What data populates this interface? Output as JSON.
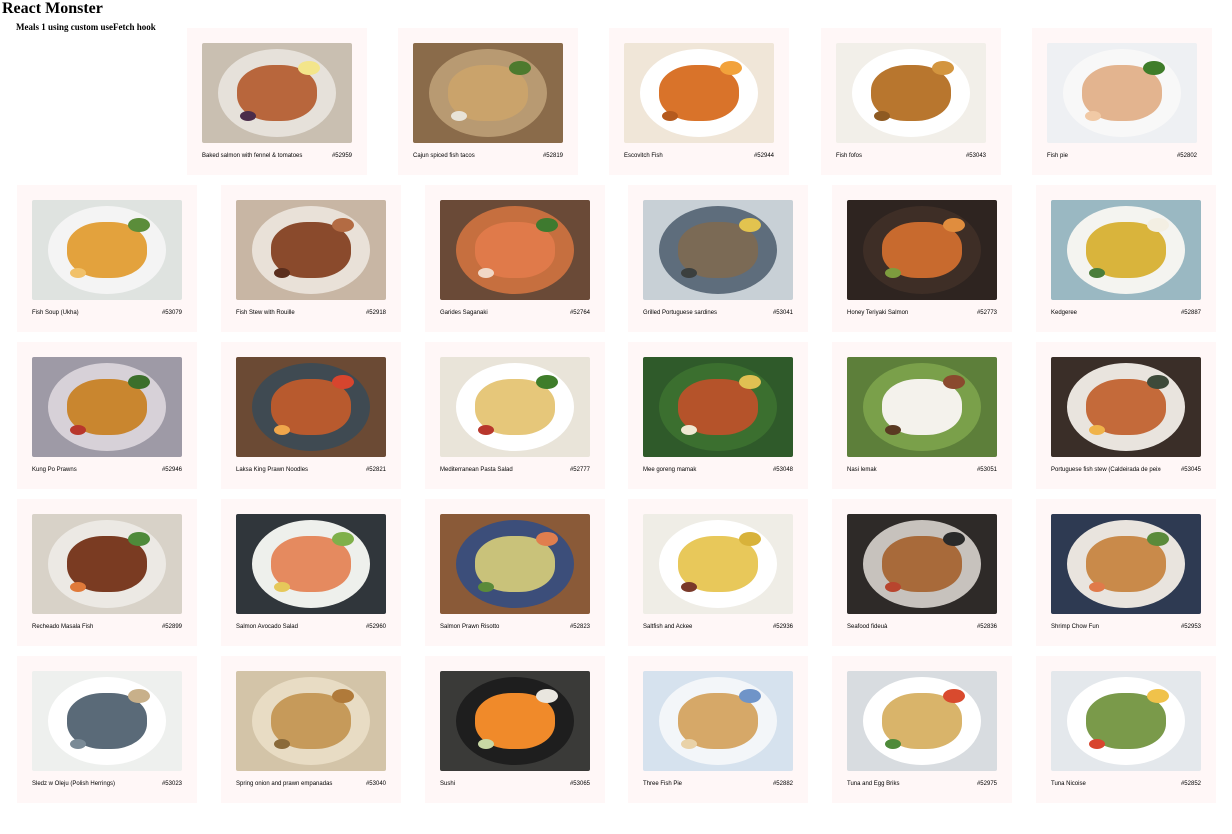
{
  "header": {
    "title": "React Monster",
    "subtitle": "Meals 1 using custom useFetch hook"
  },
  "meals": [
    {
      "name": "Baked salmon with fennel & tomatoes",
      "id": "#52959",
      "bg": "#c9bfb1",
      "plate": "#e6e1da",
      "food": "#b8663c",
      "accent": "#f3e58a",
      "accent2": "#4b2c4a"
    },
    {
      "name": "Cajun spiced fish tacos",
      "id": "#52819",
      "bg": "#8a6b4a",
      "plate": "#b89a72",
      "food": "#caa36b",
      "accent": "#4d7a2e",
      "accent2": "#e8e3d7"
    },
    {
      "name": "Escovitch Fish",
      "id": "#52944",
      "bg": "#f0e6d8",
      "plate": "#ffffff",
      "food": "#d9732a",
      "accent": "#f2a23b",
      "accent2": "#b55a1e"
    },
    {
      "name": "Fish fofos",
      "id": "#53043",
      "bg": "#f2efe9",
      "plate": "#ffffff",
      "food": "#b8762e",
      "accent": "#d3953f",
      "accent2": "#8e5a22"
    },
    {
      "name": "Fish pie",
      "id": "#52802",
      "bg": "#eef0f3",
      "plate": "#f8f8f8",
      "food": "#e3b48f",
      "accent": "#3f7d2a",
      "accent2": "#f1c9a5"
    },
    {
      "name": "Fish Soup (Ukha)",
      "id": "#53079",
      "bg": "#dfe3e0",
      "plate": "#f4f4f4",
      "food": "#e3a23d",
      "accent": "#5b8d3a",
      "accent2": "#f1c16a"
    },
    {
      "name": "Fish Stew with Rouille",
      "id": "#52918",
      "bg": "#c8b6a4",
      "plate": "#e9e1d8",
      "food": "#8a4a2c",
      "accent": "#b36b43",
      "accent2": "#5a2e1d"
    },
    {
      "name": "Garides Saganaki",
      "id": "#52764",
      "bg": "#6a4a37",
      "plate": "#c66f3f",
      "food": "#e07a4a",
      "accent": "#3e7a2f",
      "accent2": "#f1d8c6"
    },
    {
      "name": "Grilled Portuguese sardines",
      "id": "#53041",
      "bg": "#c8d0d6",
      "plate": "#5e6d7c",
      "food": "#7b6a55",
      "accent": "#e2c34f",
      "accent2": "#3b3f3e"
    },
    {
      "name": "Honey Teriyaki Salmon",
      "id": "#52773",
      "bg": "#2e2420",
      "plate": "#3e2e26",
      "food": "#c86a2e",
      "accent": "#e08d3e",
      "accent2": "#7d9c3e"
    },
    {
      "name": "Kedgeree",
      "id": "#52887",
      "bg": "#9ab8c2",
      "plate": "#f4f4f0",
      "food": "#d9b43c",
      "accent": "#f3efe3",
      "accent2": "#4a7d3a"
    },
    {
      "name": "Kung Po Prawns",
      "id": "#52946",
      "bg": "#9e9aa6",
      "plate": "#d7d1d8",
      "food": "#c9862f",
      "accent": "#3c6f2b",
      "accent2": "#b8372c"
    },
    {
      "name": "Laksa King Prawn Noodles",
      "id": "#52821",
      "bg": "#6b4a34",
      "plate": "#3f4a52",
      "food": "#b85a2e",
      "accent": "#d7452e",
      "accent2": "#efa64b"
    },
    {
      "name": "Mediterranean Pasta Salad",
      "id": "#52777",
      "bg": "#e9e4d9",
      "plate": "#ffffff",
      "food": "#e6c77a",
      "accent": "#3f7d2a",
      "accent2": "#b8372c"
    },
    {
      "name": "Mee goreng mamak",
      "id": "#53048",
      "bg": "#2f5a2a",
      "plate": "#3b6f2f",
      "food": "#b5532a",
      "accent": "#e0c052",
      "accent2": "#f0e9d2"
    },
    {
      "name": "Nasi lemak",
      "id": "#53051",
      "bg": "#5d7f3a",
      "plate": "#7aa04a",
      "food": "#f4f2ec",
      "accent": "#8a4a2e",
      "accent2": "#5a3a22"
    },
    {
      "name": "Portuguese fish stew (Caldeirada de peixe)",
      "id": "#53045",
      "bg": "#3a2e28",
      "plate": "#e9e4de",
      "food": "#c46a3a",
      "accent": "#3e4a3a",
      "accent2": "#f0b34a"
    },
    {
      "name": "Recheado Masala Fish",
      "id": "#52899",
      "bg": "#d8d2c8",
      "plate": "#ece9e4",
      "food": "#7a3b22",
      "accent": "#4e8a3a",
      "accent2": "#e07a3a"
    },
    {
      "name": "Salmon Avocado Salad",
      "id": "#52960",
      "bg": "#30363b",
      "plate": "#eef0ec",
      "food": "#e58a5f",
      "accent": "#7fb04a",
      "accent2": "#e6c85a"
    },
    {
      "name": "Salmon Prawn Risotto",
      "id": "#52823",
      "bg": "#8a5a38",
      "plate": "#3c4e7a",
      "food": "#c9c27a",
      "accent": "#e07e4e",
      "accent2": "#5a8a3a"
    },
    {
      "name": "Saltfish and Ackee",
      "id": "#52936",
      "bg": "#efede6",
      "plate": "#ffffff",
      "food": "#e8c85a",
      "accent": "#d8b23a",
      "accent2": "#7a3a2a"
    },
    {
      "name": "Seafood fideuà",
      "id": "#52836",
      "bg": "#2e2a28",
      "plate": "#c7c2bd",
      "food": "#a86a3a",
      "accent": "#2a2a2a",
      "accent2": "#b8452e"
    },
    {
      "name": "Shrimp Chow Fun",
      "id": "#52953",
      "bg": "#2e3a52",
      "plate": "#e9e4de",
      "food": "#c98a4a",
      "accent": "#5a8a3a",
      "accent2": "#e07a4a"
    },
    {
      "name": "Sledz w Oleju (Polish Herrings)",
      "id": "#53023",
      "bg": "#eef0ee",
      "plate": "#ffffff",
      "food": "#5a6a78",
      "accent": "#c8b08a",
      "accent2": "#7a8a96"
    },
    {
      "name": "Spring onion and prawn empanadas",
      "id": "#53040",
      "bg": "#d3c4a8",
      "plate": "#e8dcc4",
      "food": "#c69a5a",
      "accent": "#b07a3a",
      "accent2": "#8a6a3a"
    },
    {
      "name": "Sushi",
      "id": "#53065",
      "bg": "#3a3a38",
      "plate": "#1e1e1e",
      "food": "#f08a2a",
      "accent": "#e9e6df",
      "accent2": "#c9d8a5"
    },
    {
      "name": "Three Fish Pie",
      "id": "#52882",
      "bg": "#d6e2ee",
      "plate": "#f3f6f9",
      "food": "#d6a868",
      "accent": "#6f94c8",
      "accent2": "#e9d2a8"
    },
    {
      "name": "Tuna and Egg Briks",
      "id": "#52975",
      "bg": "#d8dce0",
      "plate": "#ffffff",
      "food": "#d9b46a",
      "accent": "#d94a2e",
      "accent2": "#4e8a3a"
    },
    {
      "name": "Tuna Nicoise",
      "id": "#52852",
      "bg": "#e4e8ec",
      "plate": "#ffffff",
      "food": "#7a9a4a",
      "accent": "#f0c24a",
      "accent2": "#d8452e"
    }
  ]
}
